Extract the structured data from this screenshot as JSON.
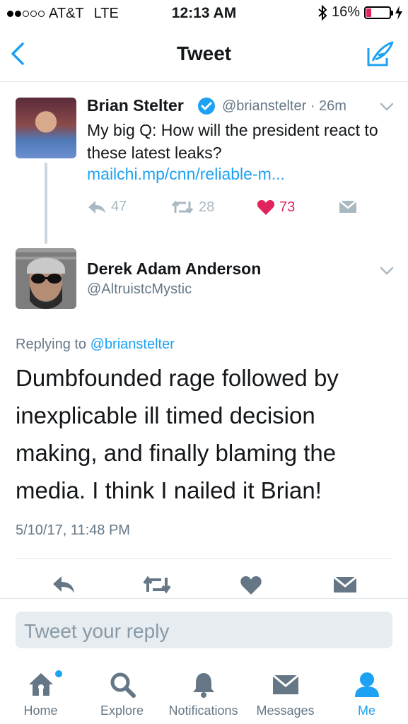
{
  "status_bar": {
    "carrier": "AT&T",
    "network": "LTE",
    "time": "12:13 AM",
    "battery": "16%",
    "battery_level": 0.16
  },
  "nav": {
    "title": "Tweet",
    "back_icon": "chevron-left-icon",
    "compose_icon": "compose-feather-icon"
  },
  "original_tweet": {
    "name": "Brian Stelter",
    "verified": true,
    "handle_time": "@brianstelter · 26m",
    "text": "My big Q: How will the president react to these latest leaks?",
    "link": "mailchi.mp/cnn/reliable-m...",
    "replies": "47",
    "retweets": "28",
    "likes": "73"
  },
  "reply_tweet": {
    "name": "Derek Adam Anderson",
    "handle": "@AltruistcMystic",
    "replying_prefix": "Replying to",
    "replying_to": "@brianstelter",
    "text": "Dumbfounded rage followed by inexplicable ill timed decision making, and finally blaming the media.  I think I nailed it Brian!",
    "timestamp": "5/10/17, 11:48 PM"
  },
  "reply_input": {
    "placeholder": "Tweet your reply"
  },
  "tabs": [
    {
      "label": "Home",
      "icon": "home-icon",
      "has_dot": true
    },
    {
      "label": "Explore",
      "icon": "search-icon"
    },
    {
      "label": "Notifications",
      "icon": "bell-icon"
    },
    {
      "label": "Messages",
      "icon": "envelope-icon"
    },
    {
      "label": "Me",
      "icon": "person-icon",
      "active": true
    }
  ],
  "colors": {
    "accent": "#1da1f2",
    "like": "#e0245e",
    "muted": "#657786",
    "icon_gray": "#aab8c2"
  }
}
